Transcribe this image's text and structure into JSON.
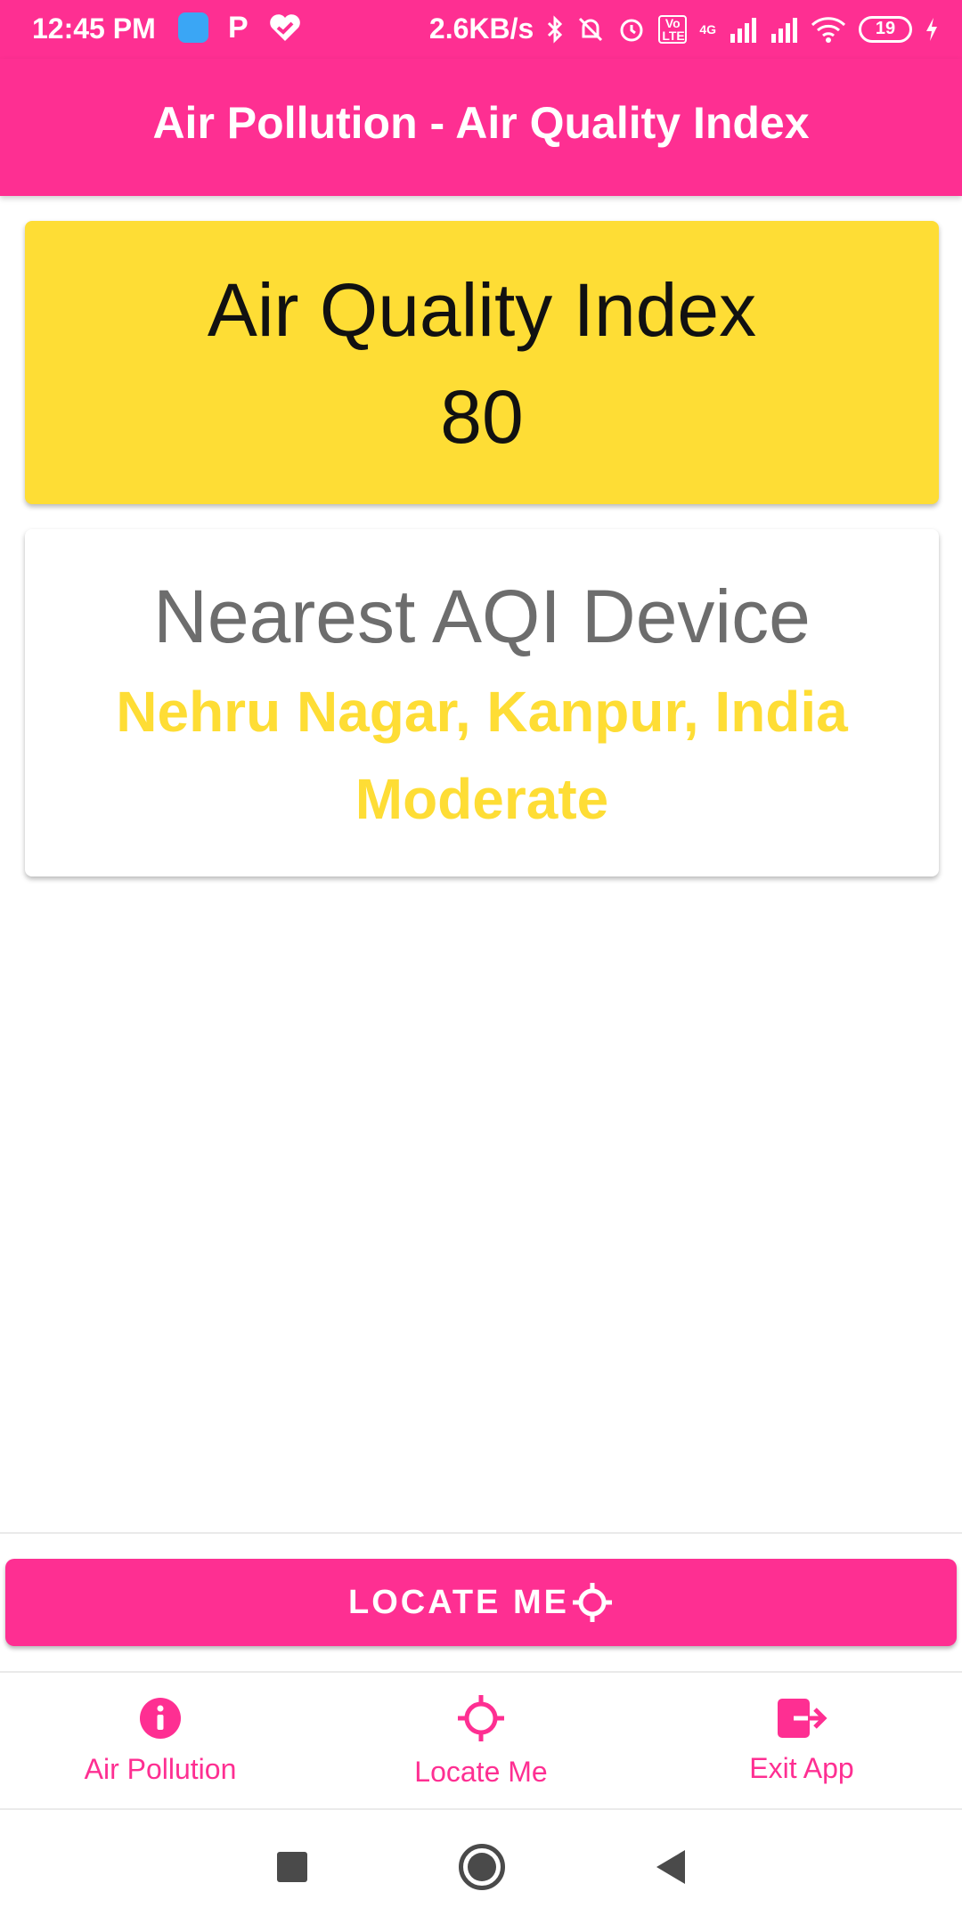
{
  "status_bar": {
    "time": "12:45 PM",
    "left_icons": [
      "blue-app-icon",
      "p-icon",
      "heart-check-icon"
    ],
    "speed": "2.6KB/s",
    "right_icons": [
      "bluetooth-icon",
      "bell-off-icon",
      "alarm-icon",
      "volte-icon",
      "signal-icon",
      "wifi-icon"
    ],
    "volte_label": "Vo LTE",
    "network_label": "4G",
    "battery_level": "19"
  },
  "app_bar": {
    "title": "Air Pollution - Air Quality Index"
  },
  "aqi_card": {
    "label": "Air Quality Index",
    "value": "80",
    "background_color": "#fedd35"
  },
  "device_card": {
    "label": "Nearest AQI Device",
    "location": "Nehru Nagar, Kanpur, India",
    "status": "Moderate",
    "accent_color": "#fedd35"
  },
  "locate_button": {
    "label": "LOCATE ME",
    "icon": "crosshair-icon"
  },
  "bottom_nav": {
    "items": [
      {
        "label": "Air Pollution",
        "icon": "info-icon"
      },
      {
        "label": "Locate Me",
        "icon": "crosshair-icon"
      },
      {
        "label": "Exit App",
        "icon": "exit-icon"
      }
    ]
  },
  "system_nav": {
    "buttons": [
      "recents-icon",
      "home-icon",
      "back-icon"
    ]
  },
  "colors": {
    "brand": "#fe2f92",
    "accent": "#fedd35"
  }
}
